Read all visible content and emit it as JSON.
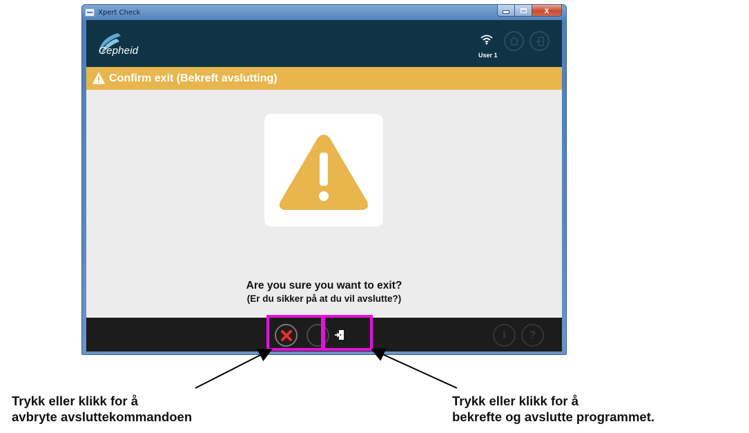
{
  "window": {
    "title": "Xpert Check",
    "close_glyph": "x"
  },
  "header": {
    "brand": "Cepheid",
    "user": "User 1",
    "icons": [
      "wifi-icon",
      "home-icon",
      "exit-icon"
    ],
    "bg_color": "#0f3446"
  },
  "banner": {
    "title": "Confirm exit  (Bekreft avslutting)",
    "bg_color": "#e8b64d",
    "icon": "warning-icon"
  },
  "dialog": {
    "icon": "warning-triangle-icon",
    "question": "Are you sure you want to exit?",
    "question_translation": "(Er du sikker på at du vil avslutte?)"
  },
  "footer": {
    "buttons": [
      "cancel-icon",
      "confirm-exit-icon",
      "info-icon",
      "help-icon"
    ],
    "info_glyph": "i",
    "help_glyph": "?"
  },
  "annotations": {
    "highlight_color": "#e610dc",
    "left_line1": "Trykk eller klikk for å",
    "left_line2": "avbryte avsluttekommandoen",
    "right_line1": "Trykk eller klikk for å",
    "right_line2": "bekrefte og avslutte programmet."
  }
}
